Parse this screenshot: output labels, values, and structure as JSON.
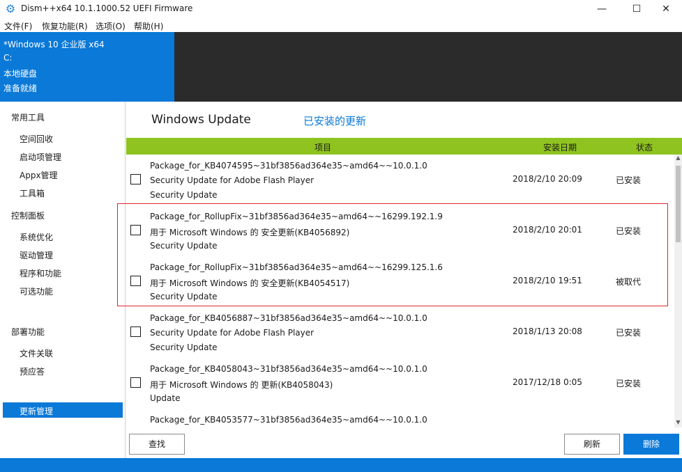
{
  "window": {
    "title": "Dism++x64 10.1.1000.52 UEFI Firmware",
    "minimize": "—",
    "maximize": "☐",
    "close": "✕"
  },
  "menu": [
    "文件(F)",
    "恢复功能(R)",
    "选项(O)",
    "帮助(H)"
  ],
  "info": {
    "os": "*Windows 10 企业版 x64",
    "drive": "C:",
    "disk": "本地硬盘",
    "status": "准备就绪"
  },
  "sidebar": {
    "section1": "常用工具",
    "items1": [
      "空间回收",
      "启动项管理",
      "Appx管理",
      "工具箱"
    ],
    "section2": "控制面板",
    "items2": [
      "系统优化",
      "驱动管理",
      "程序和功能",
      "可选功能",
      "更新管理"
    ],
    "section3": "部署功能",
    "items3": [
      "文件关联",
      "预应答"
    ]
  },
  "main": {
    "title": "Windows Update",
    "subtitle": "已安装的更新",
    "columns": {
      "item": "项目",
      "date": "安装日期",
      "status": "状态"
    }
  },
  "rows": [
    {
      "l1": "Package_for_KB4074595~31bf3856ad364e35~amd64~~10.0.1.0",
      "l2": "Security Update for Adobe Flash Player",
      "l3": "Security Update",
      "date": "2018/2/10 20:09",
      "status": "已安装"
    },
    {
      "l1": "Package_for_RollupFix~31bf3856ad364e35~amd64~~16299.192.1.9",
      "l2": "用于 Microsoft Windows 的 安全更新(KB4056892)",
      "l3": "Security Update",
      "date": "2018/2/10 20:01",
      "status": "已安装"
    },
    {
      "l1": "Package_for_RollupFix~31bf3856ad364e35~amd64~~16299.125.1.6",
      "l2": "用于 Microsoft Windows 的 安全更新(KB4054517)",
      "l3": "Security Update",
      "date": "2018/2/10 19:51",
      "status": "被取代"
    },
    {
      "l1": "Package_for_KB4056887~31bf3856ad364e35~amd64~~10.0.1.0",
      "l2": "Security Update for Adobe Flash Player",
      "l3": "Security Update",
      "date": "2018/1/13 20:08",
      "status": "已安装"
    },
    {
      "l1": "Package_for_KB4058043~31bf3856ad364e35~amd64~~10.0.1.0",
      "l2": "用于 Microsoft Windows 的 更新(KB4058043)",
      "l3": "Update",
      "date": "2017/12/18 0:05",
      "status": "已安装"
    },
    {
      "l1": "Package_for_KB4053577~31bf3856ad364e35~amd64~~10.0.1.0",
      "l2": "",
      "l3": "",
      "date": "",
      "status": ""
    }
  ],
  "buttons": {
    "find": "查找",
    "refresh": "刷新",
    "delete": "删除"
  },
  "colors": {
    "accent": "#0a79d8",
    "header": "#8fc31f",
    "highlight": "#e0242b"
  }
}
